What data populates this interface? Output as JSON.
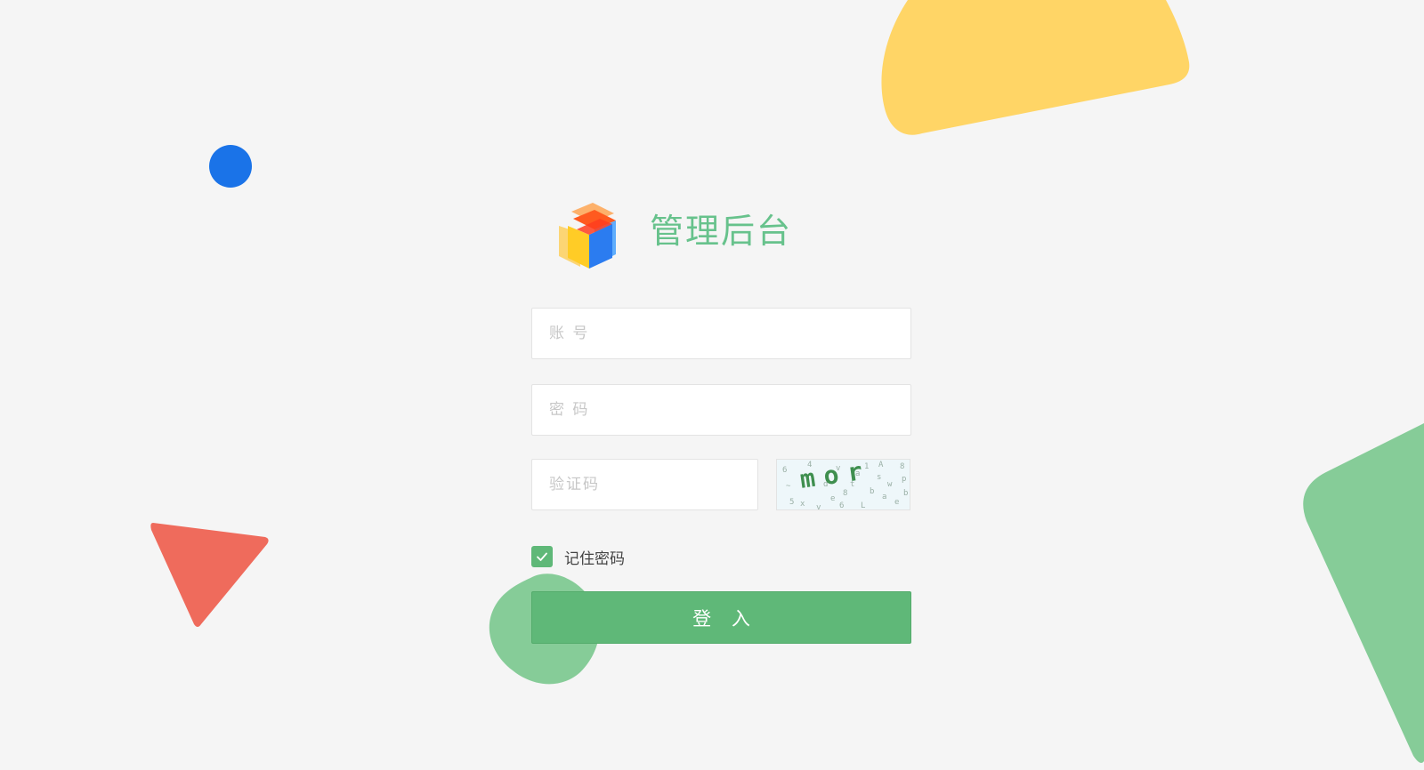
{
  "brand": {
    "title": "管理后台",
    "logo_icon": "colored-cube-logo"
  },
  "form": {
    "account_placeholder": "账 号",
    "password_placeholder": "密 码",
    "captcha_placeholder": "验证码",
    "captcha_text": "mor",
    "remember_label": "记住密码",
    "remember_checked": true,
    "login_label": "登 入"
  },
  "colors": {
    "background": "#f5f5f5",
    "primary_green": "#5fb878",
    "title_green": "#67c28c",
    "decor_yellow": "#ffd566",
    "decor_blue": "#1a73e8",
    "decor_red": "#ef6b5c",
    "decor_green": "#86cc98"
  }
}
